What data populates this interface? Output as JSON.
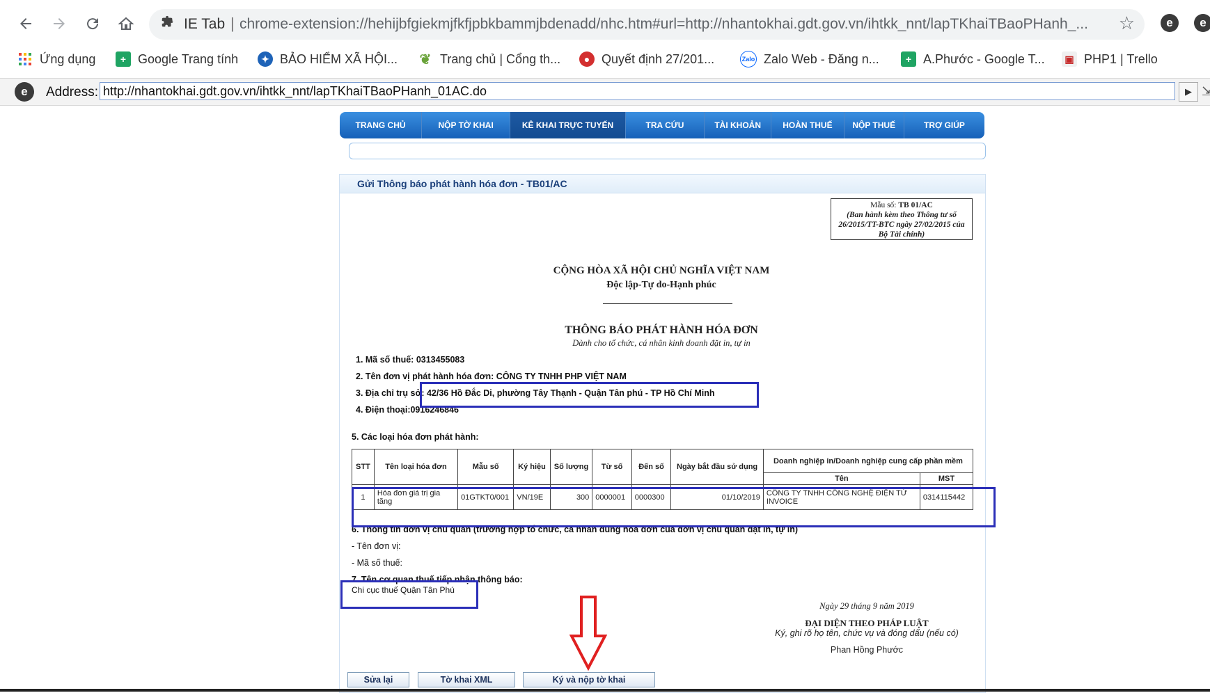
{
  "browser": {
    "ext_label": "IE Tab",
    "url": "chrome-extension://hehijbfgiekmjfkfjpbkbammjbdenadd/nhc.htm#url=http://nhantokhai.gdt.gov.vn/ihtkk_nnt/lapTKhaiTBaoPHanh_...",
    "bookmarks": [
      {
        "label": "Ứng dụng"
      },
      {
        "label": "Google Trang tính"
      },
      {
        "label": "BẢO HIỂM XÃ HỘI..."
      },
      {
        "label": "Trang chủ | Cổng th..."
      },
      {
        "label": "Quyết định 27/201..."
      },
      {
        "label": "Zalo Web - Đăng n..."
      },
      {
        "label": "A.Phước - Google T..."
      },
      {
        "label": "PHP1 | Trello"
      }
    ],
    "address_label": "Address:",
    "address_value": "http://nhantokhai.gdt.gov.vn/ihtkk_nnt/lapTKhaiTBaoPHanh_01AC.do"
  },
  "nav": {
    "tabs": [
      "TRANG CHỦ",
      "NỘP TỜ KHAI",
      "KÊ KHAI TRỰC TUYẾN",
      "TRA CỨU",
      "TÀI KHOẢN",
      "HOÀN THUẾ",
      "NỘP THUẾ",
      "TRỢ GIÚP"
    ],
    "active": "KÊ KHAI TRỰC TUYẾN"
  },
  "panel": {
    "title": "Gửi Thông báo phát hành hóa đơn - TB01/AC"
  },
  "form": {
    "mau_so_label": "Mẫu số:",
    "mau_so_value": "TB 01/AC",
    "mau_so_note": "(Ban hành kèm theo Thông tư số 26/2015/TT-BTC ngày 27/02/2015 của Bộ Tài chính)",
    "nation": "CỘNG HÒA XÃ HỘI CHỦ NGHĨA VIỆT NAM",
    "motto": "Độc lập-Tự do-Hạnh phúc",
    "doc_title": "THÔNG BÁO PHÁT HÀNH HÓA ĐƠN",
    "doc_subtitle": "Dành cho tổ chức, cá nhân kinh doanh đặt in, tự in",
    "line1": "1. Mã số thuế: 0313455083",
    "line2": "2. Tên đơn vị phát hành hóa đơn: CÔNG TY TNHH PHP VIỆT NAM",
    "line3": "3. Địa chỉ trụ sở: 42/36 Hồ Đắc Di, phường Tây Thạnh - Quận Tân phú - TP Hồ Chí Minh",
    "line4": "4. Điện thoại:0916246846",
    "line5": "5. Các loại hóa đơn phát hành:",
    "line6": "6. Thông tin đơn vị chủ quản (trường hợp tổ chức, cá nhân dùng hóa đơn của đơn vị chủ quản đặt in, tự in)",
    "line6a": "- Tên đơn vị:",
    "line6b": "- Mã số thuế:",
    "line7": "7. Tên cơ quan thuế tiếp nhận thông báo:",
    "line7_value": "Chi cục thuế Quận Tân Phú",
    "date": "Ngày 29 tháng 9 năm 2019",
    "rep_title": "ĐẠI DIỆN THEO PHÁP LUẬT",
    "rep_note": "Ký, ghi rõ họ tên, chức vụ và đóng dấu (nếu có)",
    "rep_name": "Phan Hồng Phước"
  },
  "table": {
    "headers": [
      "STT",
      "Tên loại hóa đơn",
      "Mẫu số",
      "Ký hiệu",
      "Số lượng",
      "Từ số",
      "Đến số",
      "Ngày bắt đầu sử dụng",
      "Doanh nghiệp in/Doanh nghiệp cung cấp phần mềm",
      "Tên",
      "MST"
    ],
    "row": [
      "1",
      "Hóa đơn giá trị gia tăng",
      "01GTKT0/001",
      "VN/19E",
      "300",
      "0000001",
      "0000300",
      "01/10/2019",
      "CÔNG TY TNHH CÔNG NGHỆ ĐIỆN TỬ INVOICE",
      "0314115442"
    ]
  },
  "buttons": {
    "edit": "Sửa lại",
    "xml": "Tờ khai XML",
    "sign": "Ký và nộp tờ khai"
  },
  "colors": {
    "highlight": "#2b2fb8",
    "arrow": "#e02020",
    "nav": "#1e6fcc"
  }
}
